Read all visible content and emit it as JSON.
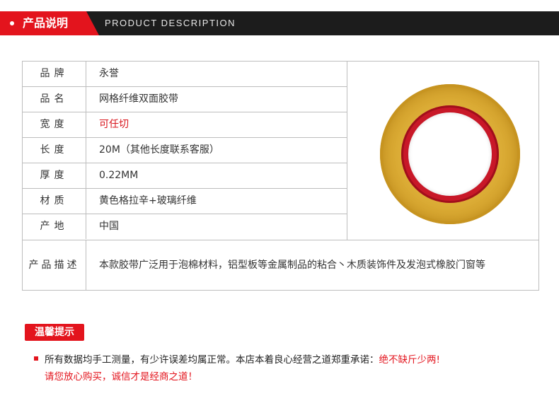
{
  "header": {
    "title_cn": "产品说明",
    "title_en": "PRODUCT DESCRIPTION"
  },
  "specs": [
    {
      "label": "品牌",
      "value": "永誉"
    },
    {
      "label": "品名",
      "value": "网格纤维双面胶带"
    },
    {
      "label": "宽度",
      "value": "可任切"
    },
    {
      "label": "长度",
      "value": "20M（其他长度联系客服）"
    },
    {
      "label": "厚度",
      "value": "0.22MM"
    },
    {
      "label": "材质",
      "value": "黄色格拉辛+玻璃纤维"
    },
    {
      "label": "产地",
      "value": "中国"
    }
  ],
  "description": {
    "label": "产品描述",
    "value": "本款胶带广泛用于泡棉材料，铝型板等金属制品的粘合丶木质装饰件及发泡式橡胶门窗等"
  },
  "tip": {
    "badge": "温馨提示",
    "line1_main": "所有数据均手工测量，有少许误差均属正常。本店本着良心经营之道郑重承诺：",
    "line1_red": "绝不缺斤少两!",
    "line2": "请您放心购买，诚信才是经商之道！"
  },
  "colors": {
    "accent": "#e3141d",
    "header_dark": "#1c1c1c",
    "border": "#bdbdbd"
  }
}
